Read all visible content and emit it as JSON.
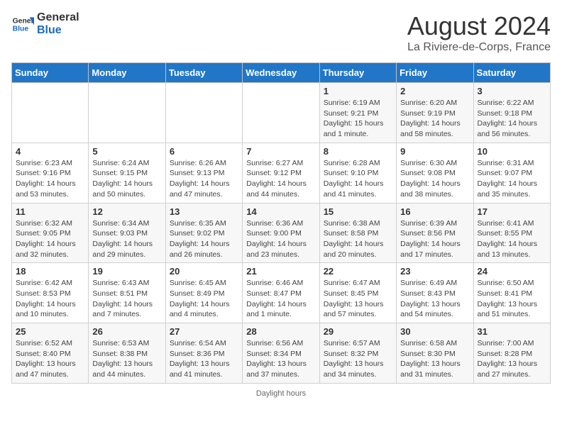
{
  "logo": {
    "line1": "General",
    "line2": "Blue"
  },
  "title": "August 2024",
  "subtitle": "La Riviere-de-Corps, France",
  "footer": "Daylight hours",
  "weekdays": [
    "Sunday",
    "Monday",
    "Tuesday",
    "Wednesday",
    "Thursday",
    "Friday",
    "Saturday"
  ],
  "weeks": [
    [
      {
        "num": "",
        "info": ""
      },
      {
        "num": "",
        "info": ""
      },
      {
        "num": "",
        "info": ""
      },
      {
        "num": "",
        "info": ""
      },
      {
        "num": "1",
        "info": "Sunrise: 6:19 AM\nSunset: 9:21 PM\nDaylight: 15 hours\nand 1 minute."
      },
      {
        "num": "2",
        "info": "Sunrise: 6:20 AM\nSunset: 9:19 PM\nDaylight: 14 hours\nand 58 minutes."
      },
      {
        "num": "3",
        "info": "Sunrise: 6:22 AM\nSunset: 9:18 PM\nDaylight: 14 hours\nand 56 minutes."
      }
    ],
    [
      {
        "num": "4",
        "info": "Sunrise: 6:23 AM\nSunset: 9:16 PM\nDaylight: 14 hours\nand 53 minutes."
      },
      {
        "num": "5",
        "info": "Sunrise: 6:24 AM\nSunset: 9:15 PM\nDaylight: 14 hours\nand 50 minutes."
      },
      {
        "num": "6",
        "info": "Sunrise: 6:26 AM\nSunset: 9:13 PM\nDaylight: 14 hours\nand 47 minutes."
      },
      {
        "num": "7",
        "info": "Sunrise: 6:27 AM\nSunset: 9:12 PM\nDaylight: 14 hours\nand 44 minutes."
      },
      {
        "num": "8",
        "info": "Sunrise: 6:28 AM\nSunset: 9:10 PM\nDaylight: 14 hours\nand 41 minutes."
      },
      {
        "num": "9",
        "info": "Sunrise: 6:30 AM\nSunset: 9:08 PM\nDaylight: 14 hours\nand 38 minutes."
      },
      {
        "num": "10",
        "info": "Sunrise: 6:31 AM\nSunset: 9:07 PM\nDaylight: 14 hours\nand 35 minutes."
      }
    ],
    [
      {
        "num": "11",
        "info": "Sunrise: 6:32 AM\nSunset: 9:05 PM\nDaylight: 14 hours\nand 32 minutes."
      },
      {
        "num": "12",
        "info": "Sunrise: 6:34 AM\nSunset: 9:03 PM\nDaylight: 14 hours\nand 29 minutes."
      },
      {
        "num": "13",
        "info": "Sunrise: 6:35 AM\nSunset: 9:02 PM\nDaylight: 14 hours\nand 26 minutes."
      },
      {
        "num": "14",
        "info": "Sunrise: 6:36 AM\nSunset: 9:00 PM\nDaylight: 14 hours\nand 23 minutes."
      },
      {
        "num": "15",
        "info": "Sunrise: 6:38 AM\nSunset: 8:58 PM\nDaylight: 14 hours\nand 20 minutes."
      },
      {
        "num": "16",
        "info": "Sunrise: 6:39 AM\nSunset: 8:56 PM\nDaylight: 14 hours\nand 17 minutes."
      },
      {
        "num": "17",
        "info": "Sunrise: 6:41 AM\nSunset: 8:55 PM\nDaylight: 14 hours\nand 13 minutes."
      }
    ],
    [
      {
        "num": "18",
        "info": "Sunrise: 6:42 AM\nSunset: 8:53 PM\nDaylight: 14 hours\nand 10 minutes."
      },
      {
        "num": "19",
        "info": "Sunrise: 6:43 AM\nSunset: 8:51 PM\nDaylight: 14 hours\nand 7 minutes."
      },
      {
        "num": "20",
        "info": "Sunrise: 6:45 AM\nSunset: 8:49 PM\nDaylight: 14 hours\nand 4 minutes."
      },
      {
        "num": "21",
        "info": "Sunrise: 6:46 AM\nSunset: 8:47 PM\nDaylight: 14 hours\nand 1 minute."
      },
      {
        "num": "22",
        "info": "Sunrise: 6:47 AM\nSunset: 8:45 PM\nDaylight: 13 hours\nand 57 minutes."
      },
      {
        "num": "23",
        "info": "Sunrise: 6:49 AM\nSunset: 8:43 PM\nDaylight: 13 hours\nand 54 minutes."
      },
      {
        "num": "24",
        "info": "Sunrise: 6:50 AM\nSunset: 8:41 PM\nDaylight: 13 hours\nand 51 minutes."
      }
    ],
    [
      {
        "num": "25",
        "info": "Sunrise: 6:52 AM\nSunset: 8:40 PM\nDaylight: 13 hours\nand 47 minutes."
      },
      {
        "num": "26",
        "info": "Sunrise: 6:53 AM\nSunset: 8:38 PM\nDaylight: 13 hours\nand 44 minutes."
      },
      {
        "num": "27",
        "info": "Sunrise: 6:54 AM\nSunset: 8:36 PM\nDaylight: 13 hours\nand 41 minutes."
      },
      {
        "num": "28",
        "info": "Sunrise: 6:56 AM\nSunset: 8:34 PM\nDaylight: 13 hours\nand 37 minutes."
      },
      {
        "num": "29",
        "info": "Sunrise: 6:57 AM\nSunset: 8:32 PM\nDaylight: 13 hours\nand 34 minutes."
      },
      {
        "num": "30",
        "info": "Sunrise: 6:58 AM\nSunset: 8:30 PM\nDaylight: 13 hours\nand 31 minutes."
      },
      {
        "num": "31",
        "info": "Sunrise: 7:00 AM\nSunset: 8:28 PM\nDaylight: 13 hours\nand 27 minutes."
      }
    ]
  ]
}
